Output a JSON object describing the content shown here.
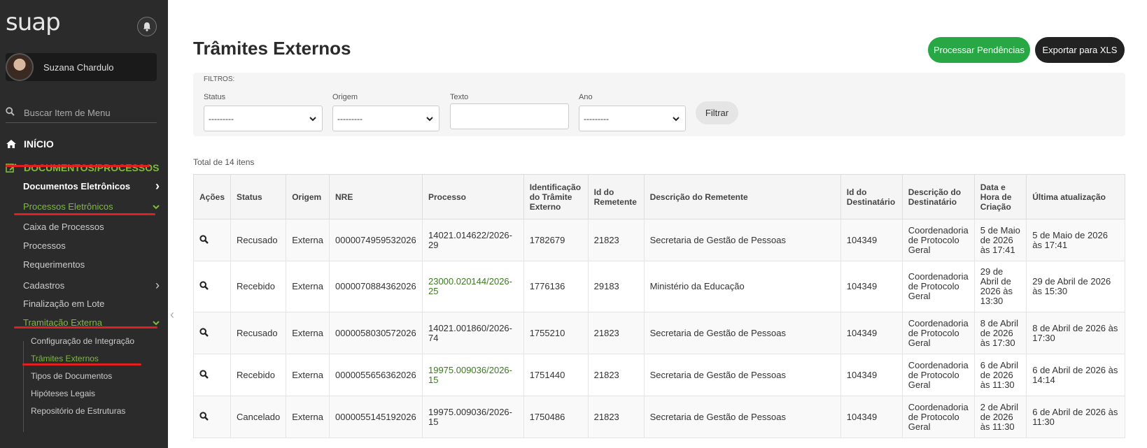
{
  "app": {
    "logo": "suap",
    "user_name": "Suzana Chardulo",
    "search_placeholder": "Buscar Item de Menu"
  },
  "sidebar": {
    "inicio": "INÍCIO",
    "docs": "DOCUMENTOS/PROCESSOS",
    "items": [
      {
        "label": "Documentos Eletrônicos",
        "chevron": "›"
      },
      {
        "label": "Processos Eletrônicos",
        "chevron": "⌄"
      },
      {
        "label": "Caixa de Processos"
      },
      {
        "label": "Processos"
      },
      {
        "label": "Requerimentos"
      },
      {
        "label": "Cadastros",
        "chevron": "›"
      },
      {
        "label": "Finalização em Lote"
      },
      {
        "label": "Tramitação Externa",
        "chevron": "⌄"
      }
    ],
    "subitems": [
      {
        "label": "Configuração de Integração"
      },
      {
        "label": "Trâmites Externos"
      },
      {
        "label": "Tipos de Documentos"
      },
      {
        "label": "Hipóteses Legais"
      },
      {
        "label": "Repositório de Estruturas"
      }
    ]
  },
  "main": {
    "title": "Trâmites Externos",
    "btn_process": "Processar Pendências",
    "btn_export": "Exportar para XLS",
    "filters": {
      "title": "FILTROS:",
      "status_label": "Status",
      "status_value": "---------",
      "origem_label": "Origem",
      "origem_value": "---------",
      "texto_label": "Texto",
      "ano_label": "Ano",
      "ano_value": "---------",
      "btn": "Filtrar"
    },
    "total": "Total de 14 itens",
    "columns": [
      "Ações",
      "Status",
      "Origem",
      "NRE",
      "Processo",
      "Identificação do Trâmite Externo",
      "Id do Remetente",
      "Descrição do Remetente",
      "Id do Destinatário",
      "Descrição do Destinatário",
      "Data e Hora de Criação",
      "Última atualização"
    ],
    "rows": [
      {
        "status": "Recusado",
        "origem": "Externa",
        "nre": "0000074959532026",
        "processo": "14021.014622/2026-29",
        "processo_link": false,
        "tramite": "1782679",
        "id_rem": "21823",
        "desc_rem": "Secretaria de Gestão de Pessoas",
        "id_dest": "104349",
        "desc_dest": "Coordenadoria de Protocolo Geral",
        "criacao": "5 de Maio de 2026 às 17:41",
        "atualizacao": "5 de Maio de 2026 às 17:41"
      },
      {
        "status": "Recebido",
        "origem": "Externa",
        "nre": "0000070884362026",
        "processo": "23000.020144/2026-25",
        "processo_link": true,
        "tramite": "1776136",
        "id_rem": "29183",
        "desc_rem": "Ministério da Educação",
        "id_dest": "104349",
        "desc_dest": "Coordenadoria de Protocolo Geral",
        "criacao": "29 de Abril de 2026 às 13:30",
        "atualizacao": "29 de Abril de 2026 às 15:30"
      },
      {
        "status": "Recusado",
        "origem": "Externa",
        "nre": "0000058030572026",
        "processo": "14021.001860/2026-74",
        "processo_link": false,
        "tramite": "1755210",
        "id_rem": "21823",
        "desc_rem": "Secretaria de Gestão de Pessoas",
        "id_dest": "104349",
        "desc_dest": "Coordenadoria de Protocolo Geral",
        "criacao": "8 de Abril de 2026 às 17:30",
        "atualizacao": "8 de Abril de 2026 às 17:30"
      },
      {
        "status": "Recebido",
        "origem": "Externa",
        "nre": "0000055656362026",
        "processo": "19975.009036/2026-15",
        "processo_link": true,
        "tramite": "1751440",
        "id_rem": "21823",
        "desc_rem": "Secretaria de Gestão de Pessoas",
        "id_dest": "104349",
        "desc_dest": "Coordenadoria de Protocolo Geral",
        "criacao": "6 de Abril de 2026 às 11:30",
        "atualizacao": "6 de Abril de 2026 às 14:14"
      },
      {
        "status": "Cancelado",
        "origem": "Externa",
        "nre": "0000055145192026",
        "processo": "19975.009036/2026-15",
        "processo_link": false,
        "tramite": "1750486",
        "id_rem": "21823",
        "desc_rem": "Secretaria de Gestão de Pessoas",
        "id_dest": "104349",
        "desc_dest": "Coordenadoria de Protocolo Geral",
        "criacao": "2 de Abril de 2026 às 11:30",
        "atualizacao": "6 de Abril de 2026 às 11:30"
      }
    ]
  }
}
